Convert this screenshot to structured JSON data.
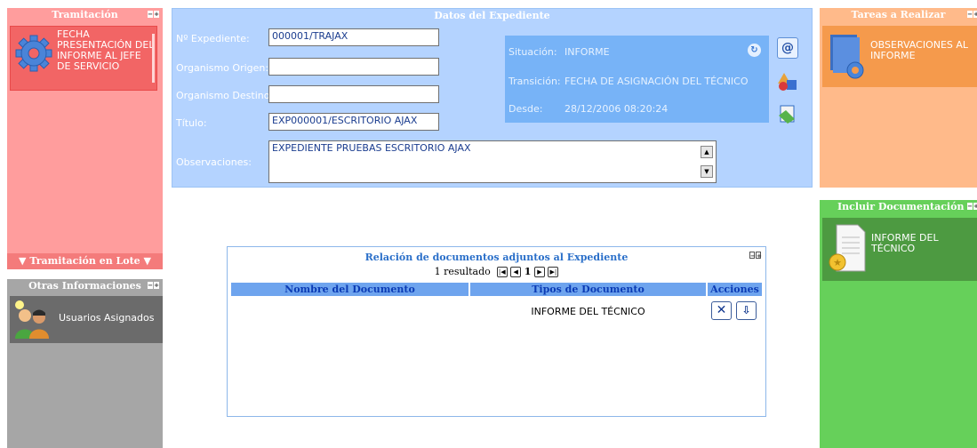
{
  "tramitacion": {
    "title": "Tramitación",
    "item_label": "FECHA PRESENTACIÓN DEL INFORME AL JEFE DE SERVICIO",
    "footer": "▼ Tramitación en Lote ▼"
  },
  "otras": {
    "title": "Otras Informaciones",
    "item_label": "Usuarios Asignados"
  },
  "datos": {
    "title": "Datos del Expediente",
    "fields": {
      "expediente_label": "Nº Expediente:",
      "expediente_value": "000001/TRAJAX",
      "origen_label": "Organismo Origen:",
      "origen_value": "",
      "destino_label": "Organismo Destino:",
      "destino_value": "",
      "titulo_label": "Título:",
      "titulo_value": "EXP000001/ESCRITORIO AJAX",
      "observaciones_label": "Observaciones:",
      "observaciones_value": "EXPEDIENTE PRUEBAS ESCRITORIO AJAX"
    },
    "situacion": {
      "situacion_label": "Situación:",
      "situacion_value": "INFORME",
      "transicion_label": "Transición:",
      "transicion_value": "FECHA DE ASIGNACIÓN DEL TÉCNICO",
      "desde_label": "Desde:",
      "desde_value": "28/12/2006 08:20:24"
    }
  },
  "tareas": {
    "title": "Tareas a Realizar",
    "item_label": "OBSERVACIONES AL INFORME"
  },
  "incluir": {
    "title": "Incluir Documentación",
    "item_label": "INFORME DEL TÉCNICO"
  },
  "relacion": {
    "title": "Relación de documentos adjuntos al Expediente",
    "results": "1 resultado",
    "page": "1",
    "columns": [
      "Nombre del Documento",
      "Tipos de Documento",
      "Acciones"
    ],
    "rows": [
      {
        "nombre": "",
        "tipo": "INFORME DEL TÉCNICO"
      }
    ]
  },
  "colors": {
    "tramitacion": "#ff9d9d",
    "tareas": "#ffba8a",
    "incluir": "#66d05a",
    "datos": "#b4d3ff",
    "otras": "#a6a6a6"
  }
}
